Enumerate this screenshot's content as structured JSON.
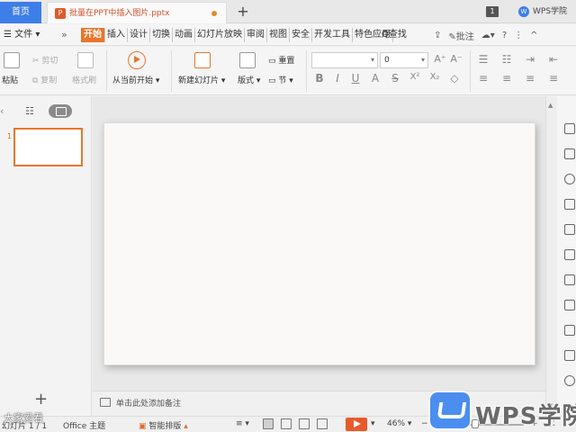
{
  "titlebar": {
    "home_tab": "首页",
    "doc_icon": "P",
    "doc_tab": "批量在PPT中插入图片.pptx",
    "add_tab": "+",
    "window_count": "1",
    "brand": "WPS学院",
    "brand_logo": "W"
  },
  "menubar": {
    "file": "☰ 文件 ▾",
    "more": "»",
    "tabs": [
      "开始",
      "插入",
      "设计",
      "切换",
      "动画",
      "幻灯片放映",
      "审阅",
      "视图",
      "安全",
      "开发工具",
      "特色应用"
    ],
    "search": "Q查找",
    "comment": "批注",
    "help": "?",
    "more_dots": "⋮",
    "collapse": "^"
  },
  "ribbon": {
    "paste": "粘贴",
    "cut": "剪切",
    "copy": "复制",
    "format_painter": "格式刷",
    "play_from_current": "从当前开始",
    "new_slide": "新建幻灯片",
    "layout": "版式",
    "reset": "重置",
    "section": "节",
    "font_name": "",
    "font_size": "0",
    "bold": "B",
    "italic": "I",
    "underline": "U",
    "strike": "S",
    "superscript": "X²",
    "subscript": "X₂",
    "grow_font": "A⁺",
    "shrink_font": "A⁻",
    "clear_format": "◇"
  },
  "leftpanel": {
    "collapse_arrow": "‹",
    "outline": "☷",
    "slide_number": "1",
    "add_slide": "+"
  },
  "notes": {
    "placeholder": "单击此处添加备注"
  },
  "statusbar": {
    "slide_info": "幻灯片 1 / 1",
    "theme": "Office 主题",
    "smart_layout": "智能排版",
    "notes_btn": "≡",
    "zoom": "46%",
    "zoom_minus": "−",
    "zoom_plus": "+"
  },
  "watermark": {
    "text": "WPS学院",
    "left_text": "大家爱看"
  }
}
